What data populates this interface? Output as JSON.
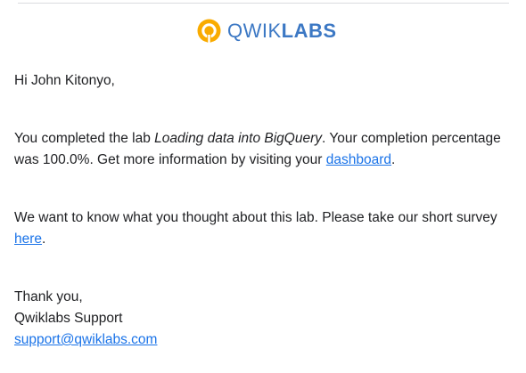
{
  "brand": {
    "name_part1": "QWIK",
    "name_part2": "LABS",
    "accent_color": "#f9ab00",
    "text_color": "#3c78c4",
    "icon": "qwiklabs-logo-icon"
  },
  "email": {
    "greeting": "Hi John Kitonyo,",
    "completion": {
      "intro": "You completed the lab ",
      "lab_name": "Loading data into BigQuery",
      "middle": ". Your completion percentage was 100.0%. Get more information by visiting your ",
      "link_text": "dashboard",
      "end": "."
    },
    "survey": {
      "intro": "We want to know what you thought about this lab. Please take our short survey ",
      "link_text": "here",
      "end": "."
    },
    "signoff": {
      "thanks": "Thank you,",
      "team": "Qwiklabs Support",
      "email_link": "support@qwiklabs.com"
    },
    "link_color": "#1a73e8"
  }
}
